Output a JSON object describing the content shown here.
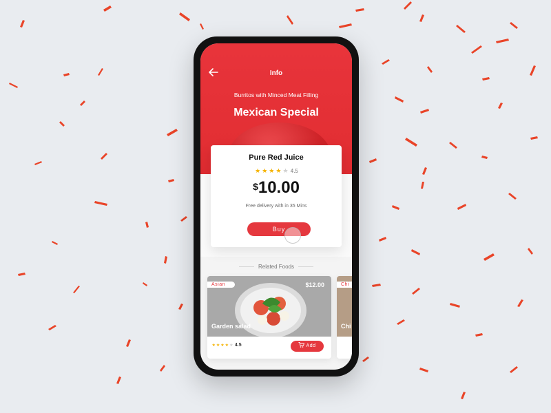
{
  "header": {
    "back_icon": "arrow-left-icon",
    "title": "Info"
  },
  "hero": {
    "subtitle": "Burritos with Minced Meat Filling",
    "headline": "Mexican Special"
  },
  "product": {
    "name": "Pure Red Juice",
    "rating_stars_filled": 4,
    "rating_value": "4.5",
    "currency": "$",
    "price": "10.00",
    "delivery": "Free delivery with in 35 Mins",
    "buy_label": "Buy"
  },
  "related": {
    "label": "Related Foods",
    "items": [
      {
        "tag": "Asian",
        "price": "$12.00",
        "name": "Garden salad",
        "rating": "4.5",
        "add_label": "Add",
        "cart_icon": "cart-icon"
      },
      {
        "tag": "Chi",
        "name": "Chi"
      }
    ]
  },
  "colors": {
    "accent": "#e5383e",
    "background": "#e9ecf0",
    "star": "#f5b301"
  }
}
